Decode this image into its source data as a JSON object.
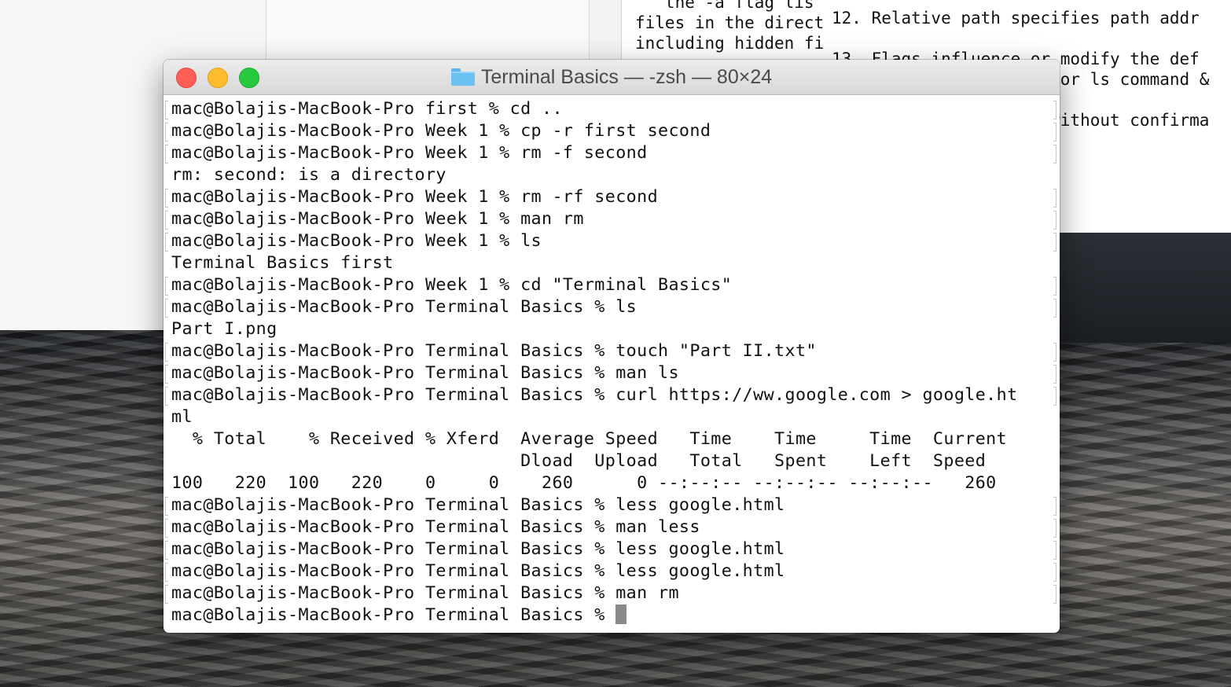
{
  "background_notes": {
    "middle_lines": [
      "   the -a flag lis",
      "files in the direct",
      "including hidden fi"
    ],
    "right_lines": [
      "12. Relative path specifies path addr",
      "",
      "13. Flags influence or modify the def",
      "                      for ls command &",
      "",
      "                      without confirma"
    ]
  },
  "window": {
    "title": "Terminal Basics — -zsh — 80×24",
    "folder_icon": "folder-icon"
  },
  "terminal": {
    "lines": [
      "mac@Bolajis-MacBook-Pro first % cd ..",
      "mac@Bolajis-MacBook-Pro Week 1 % cp -r first second",
      "mac@Bolajis-MacBook-Pro Week 1 % rm -f second",
      "rm: second: is a directory",
      "mac@Bolajis-MacBook-Pro Week 1 % rm -rf second",
      "mac@Bolajis-MacBook-Pro Week 1 % man rm",
      "mac@Bolajis-MacBook-Pro Week 1 % ls",
      "Terminal Basics first",
      "mac@Bolajis-MacBook-Pro Week 1 % cd \"Terminal Basics\"",
      "mac@Bolajis-MacBook-Pro Terminal Basics % ls",
      "Part I.png",
      "mac@Bolajis-MacBook-Pro Terminal Basics % touch \"Part II.txt\"",
      "mac@Bolajis-MacBook-Pro Terminal Basics % man ls",
      "mac@Bolajis-MacBook-Pro Terminal Basics % curl https://ww.google.com > google.ht",
      "ml",
      "  % Total    % Received % Xferd  Average Speed   Time    Time     Time  Current",
      "                                 Dload  Upload   Total   Spent    Left  Speed",
      "100   220  100   220    0     0    260      0 --:--:-- --:--:-- --:--:--   260",
      "mac@Bolajis-MacBook-Pro Terminal Basics % less google.html",
      "mac@Bolajis-MacBook-Pro Terminal Basics % man less",
      "mac@Bolajis-MacBook-Pro Terminal Basics % less google.html",
      "mac@Bolajis-MacBook-Pro Terminal Basics % less google.html",
      "mac@Bolajis-MacBook-Pro Terminal Basics % man rm",
      "mac@Bolajis-MacBook-Pro Terminal Basics % "
    ],
    "marked_lines": [
      0,
      1,
      2,
      4,
      5,
      6,
      8,
      9,
      11,
      12,
      13,
      18,
      19,
      20,
      21,
      22
    ]
  }
}
